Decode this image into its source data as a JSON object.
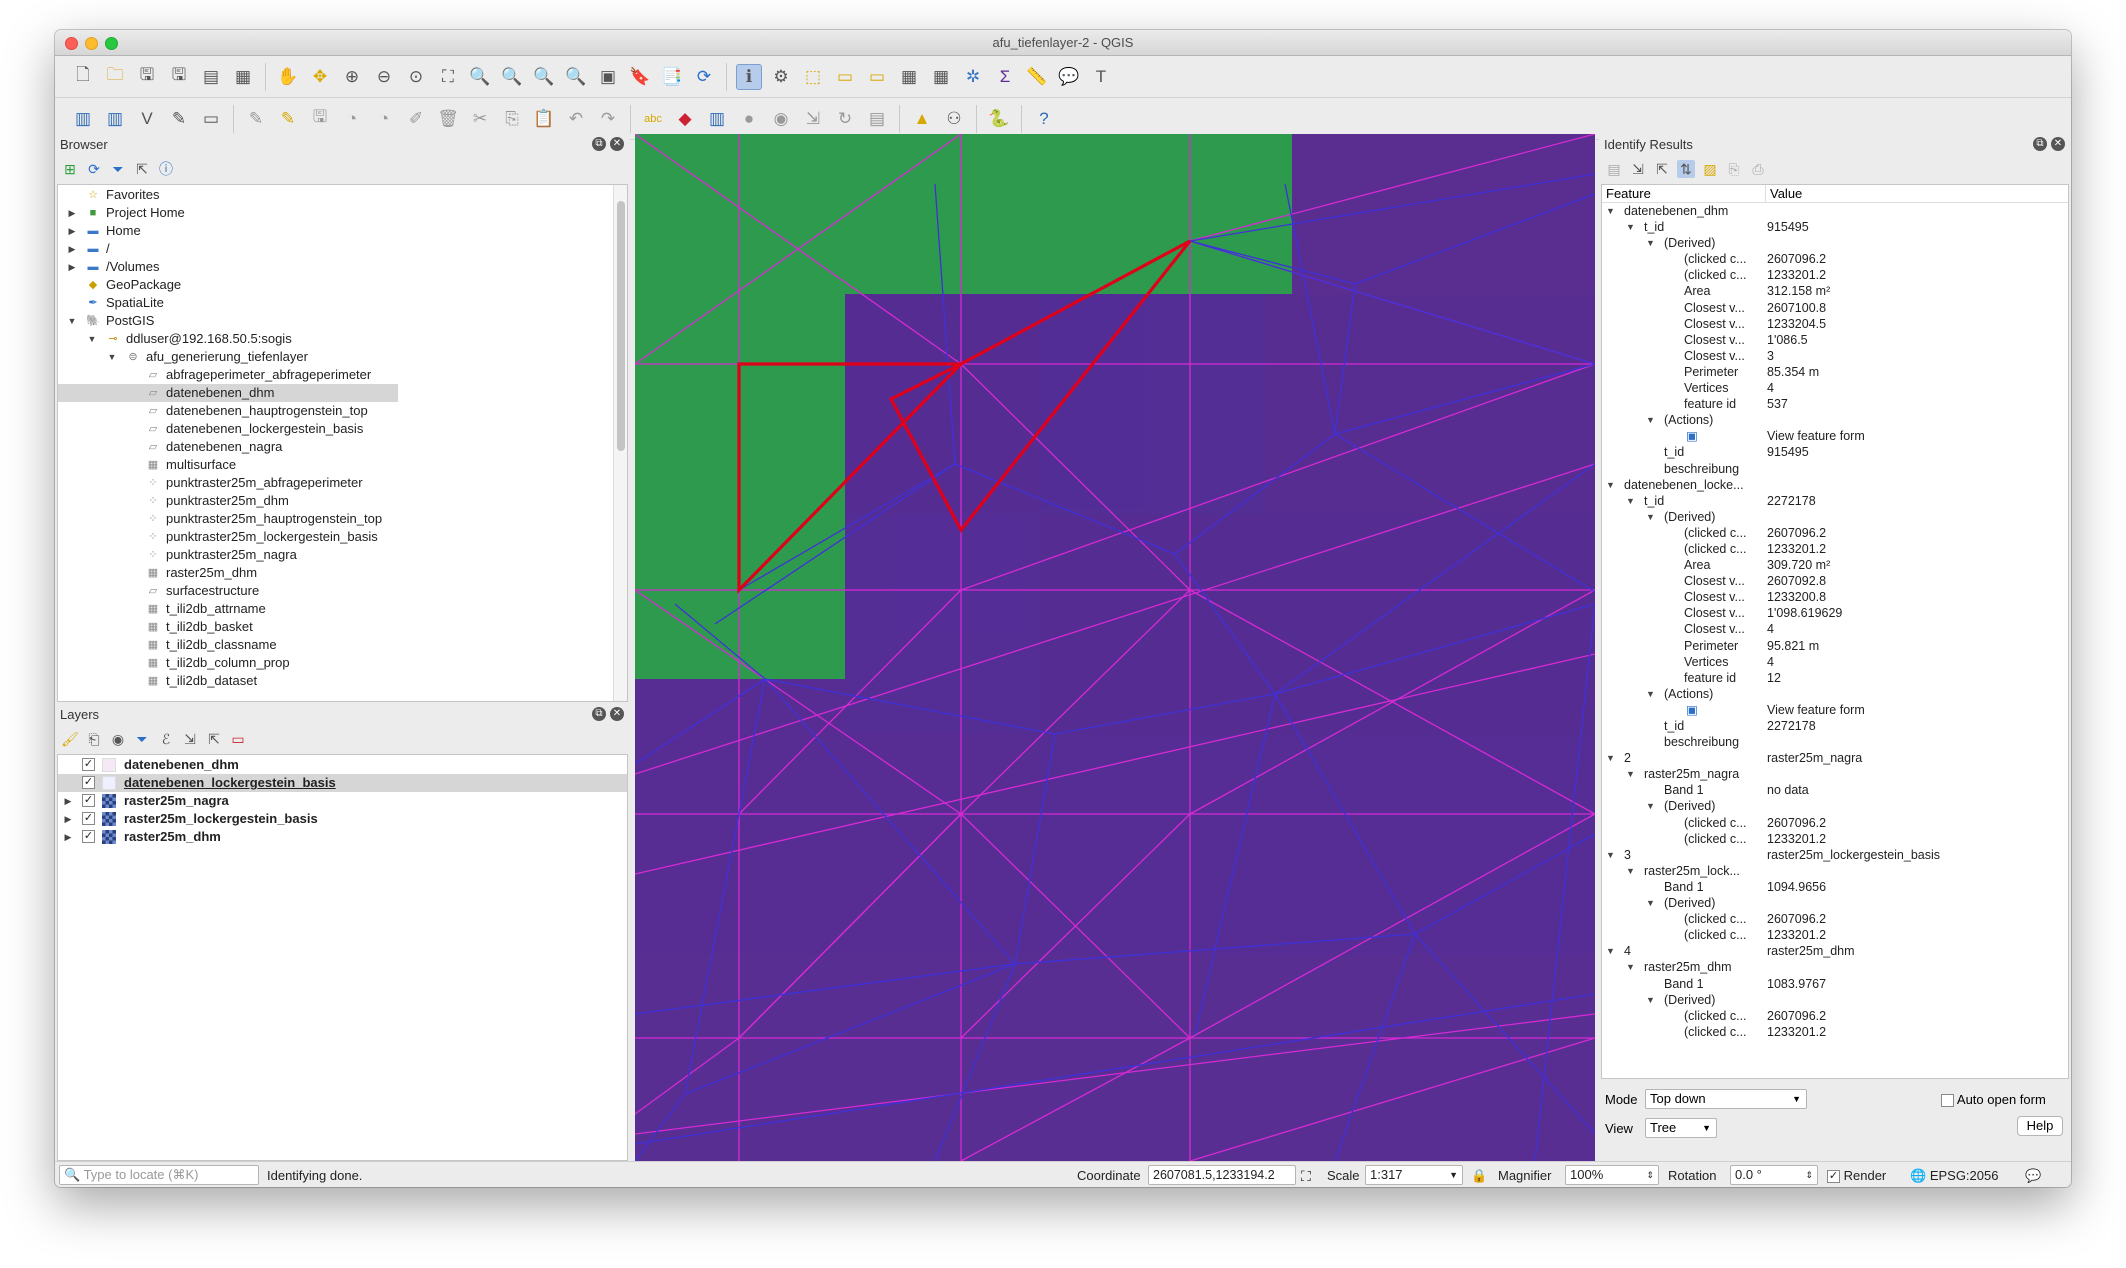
{
  "window": {
    "title": "afu_tiefenlayer-2 - QGIS"
  },
  "colors": {
    "map_bg": "#552c91",
    "green": "#2e9a4e",
    "red": "#e0001a",
    "magenta": "#d62ad3",
    "blue": "#3f31d9"
  },
  "browser": {
    "title": "Browser",
    "items": [
      {
        "label": "Favorites",
        "icon": "star-icon",
        "level": 0,
        "expand": ""
      },
      {
        "label": "Project Home",
        "icon": "project-home-icon",
        "level": 0,
        "expand": "▶"
      },
      {
        "label": "Home",
        "icon": "folder-icon",
        "level": 0,
        "expand": "▶"
      },
      {
        "label": "/",
        "icon": "folder-icon",
        "level": 0,
        "expand": "▶"
      },
      {
        "label": "/Volumes",
        "icon": "folder-icon",
        "level": 0,
        "expand": "▶"
      },
      {
        "label": "GeoPackage",
        "icon": "geopackage-icon",
        "level": 0,
        "expand": ""
      },
      {
        "label": "SpatiaLite",
        "icon": "spatialite-icon",
        "level": 0,
        "expand": ""
      },
      {
        "label": "PostGIS",
        "icon": "postgis-icon",
        "level": 0,
        "expand": "▼"
      },
      {
        "label": "ddluser@192.168.50.5:sogis",
        "icon": "connection-icon",
        "level": 1,
        "expand": "▼"
      },
      {
        "label": "afu_generierung_tiefenlayer",
        "icon": "schema-icon",
        "level": 2,
        "expand": "▼"
      },
      {
        "label": "abfrageperimeter_abfrageperimeter",
        "icon": "polygon-layer-icon",
        "level": 3,
        "expand": ""
      },
      {
        "label": "datenebenen_dhm",
        "icon": "polygon-layer-icon",
        "level": 3,
        "expand": "",
        "selected": true
      },
      {
        "label": "datenebenen_hauptrogenstein_top",
        "icon": "polygon-layer-icon",
        "level": 3,
        "expand": ""
      },
      {
        "label": "datenebenen_lockergestein_basis",
        "icon": "polygon-layer-icon",
        "level": 3,
        "expand": ""
      },
      {
        "label": "datenebenen_nagra",
        "icon": "polygon-layer-icon",
        "level": 3,
        "expand": ""
      },
      {
        "label": "multisurface",
        "icon": "table-icon",
        "level": 3,
        "expand": ""
      },
      {
        "label": "punktraster25m_abfrageperimeter",
        "icon": "point-layer-icon",
        "level": 3,
        "expand": ""
      },
      {
        "label": "punktraster25m_dhm",
        "icon": "point-layer-icon",
        "level": 3,
        "expand": ""
      },
      {
        "label": "punktraster25m_hauptrogenstein_top",
        "icon": "point-layer-icon",
        "level": 3,
        "expand": ""
      },
      {
        "label": "punktraster25m_lockergestein_basis",
        "icon": "point-layer-icon",
        "level": 3,
        "expand": ""
      },
      {
        "label": "punktraster25m_nagra",
        "icon": "point-layer-icon",
        "level": 3,
        "expand": ""
      },
      {
        "label": "raster25m_dhm",
        "icon": "table-icon",
        "level": 3,
        "expand": ""
      },
      {
        "label": "surfacestructure",
        "icon": "polygon-layer-icon",
        "level": 3,
        "expand": ""
      },
      {
        "label": "t_ili2db_attrname",
        "icon": "table-icon",
        "level": 3,
        "expand": ""
      },
      {
        "label": "t_ili2db_basket",
        "icon": "table-icon",
        "level": 3,
        "expand": ""
      },
      {
        "label": "t_ili2db_classname",
        "icon": "table-icon",
        "level": 3,
        "expand": ""
      },
      {
        "label": "t_ili2db_column_prop",
        "icon": "table-icon",
        "level": 3,
        "expand": ""
      },
      {
        "label": "t_ili2db_dataset",
        "icon": "table-icon",
        "level": 3,
        "expand": ""
      }
    ]
  },
  "layers": {
    "title": "Layers",
    "items": [
      {
        "label": "datenebenen_dhm",
        "expand": "",
        "checked": "✓",
        "swatch": "#f4e9f4",
        "underline": false
      },
      {
        "label": "datenebenen_lockergestein_basis",
        "expand": "",
        "checked": "✓",
        "swatch": "#eef0ff",
        "underline": true,
        "selected": true
      },
      {
        "label": "raster25m_nagra",
        "expand": "▶",
        "checked": "✓",
        "swatch": "raster",
        "underline": false
      },
      {
        "label": "raster25m_lockergestein_basis",
        "expand": "▶",
        "checked": "✓",
        "swatch": "raster",
        "underline": false
      },
      {
        "label": "raster25m_dhm",
        "expand": "▶",
        "checked": "✓",
        "swatch": "raster",
        "underline": false
      }
    ]
  },
  "identify": {
    "title": "Identify Results",
    "col_feature": "Feature",
    "col_value": "Value",
    "rows": [
      {
        "k": "datenebenen_dhm",
        "v": "",
        "lvl": 0,
        "a": "▼"
      },
      {
        "k": "t_id",
        "v": "915495",
        "lvl": 1,
        "a": "▼"
      },
      {
        "k": "(Derived)",
        "v": "",
        "lvl": 2,
        "a": "▼"
      },
      {
        "k": "(clicked c...",
        "v": "2607096.2",
        "lvl": 3,
        "a": ""
      },
      {
        "k": "(clicked c...",
        "v": "1233201.2",
        "lvl": 3,
        "a": ""
      },
      {
        "k": "Area",
        "v": "312.158 m²",
        "lvl": 3,
        "a": ""
      },
      {
        "k": "Closest v...",
        "v": "2607100.8",
        "lvl": 3,
        "a": ""
      },
      {
        "k": "Closest v...",
        "v": "1233204.5",
        "lvl": 3,
        "a": ""
      },
      {
        "k": "Closest v...",
        "v": "1'086.5",
        "lvl": 3,
        "a": ""
      },
      {
        "k": "Closest v...",
        "v": "3",
        "lvl": 3,
        "a": ""
      },
      {
        "k": "Perimeter",
        "v": "85.354 m",
        "lvl": 3,
        "a": ""
      },
      {
        "k": "Vertices",
        "v": "4",
        "lvl": 3,
        "a": ""
      },
      {
        "k": "feature id",
        "v": "537",
        "lvl": 3,
        "a": ""
      },
      {
        "k": "(Actions)",
        "v": "",
        "lvl": 2,
        "a": "▼"
      },
      {
        "k": "▣",
        "v": "View feature form",
        "lvl": 3,
        "a": ""
      },
      {
        "k": "t_id",
        "v": "915495",
        "lvl": 2,
        "a": ""
      },
      {
        "k": "beschreibung",
        "v": "",
        "lvl": 2,
        "a": ""
      },
      {
        "k": "datenebenen_locke...",
        "v": "",
        "lvl": 0,
        "a": "▼"
      },
      {
        "k": "t_id",
        "v": "2272178",
        "lvl": 1,
        "a": "▼"
      },
      {
        "k": "(Derived)",
        "v": "",
        "lvl": 2,
        "a": "▼"
      },
      {
        "k": "(clicked c...",
        "v": "2607096.2",
        "lvl": 3,
        "a": ""
      },
      {
        "k": "(clicked c...",
        "v": "1233201.2",
        "lvl": 3,
        "a": ""
      },
      {
        "k": "Area",
        "v": "309.720 m²",
        "lvl": 3,
        "a": ""
      },
      {
        "k": "Closest v...",
        "v": "2607092.8",
        "lvl": 3,
        "a": ""
      },
      {
        "k": "Closest v...",
        "v": "1233200.8",
        "lvl": 3,
        "a": ""
      },
      {
        "k": "Closest v...",
        "v": "1'098.619629",
        "lvl": 3,
        "a": ""
      },
      {
        "k": "Closest v...",
        "v": "4",
        "lvl": 3,
        "a": ""
      },
      {
        "k": "Perimeter",
        "v": "95.821 m",
        "lvl": 3,
        "a": ""
      },
      {
        "k": "Vertices",
        "v": "4",
        "lvl": 3,
        "a": ""
      },
      {
        "k": "feature id",
        "v": "12",
        "lvl": 3,
        "a": ""
      },
      {
        "k": "(Actions)",
        "v": "",
        "lvl": 2,
        "a": "▼"
      },
      {
        "k": "▣",
        "v": "View feature form",
        "lvl": 3,
        "a": ""
      },
      {
        "k": "t_id",
        "v": "2272178",
        "lvl": 2,
        "a": ""
      },
      {
        "k": "beschreibung",
        "v": "",
        "lvl": 2,
        "a": ""
      },
      {
        "k": "2",
        "v": "raster25m_nagra",
        "lvl": 0,
        "a": "▼"
      },
      {
        "k": "raster25m_nagra",
        "v": "",
        "lvl": 1,
        "a": "▼"
      },
      {
        "k": "Band 1",
        "v": "no data",
        "lvl": 2,
        "a": ""
      },
      {
        "k": "(Derived)",
        "v": "",
        "lvl": 2,
        "a": "▼"
      },
      {
        "k": "(clicked c...",
        "v": "2607096.2",
        "lvl": 3,
        "a": ""
      },
      {
        "k": "(clicked c...",
        "v": "1233201.2",
        "lvl": 3,
        "a": ""
      },
      {
        "k": "3",
        "v": "raster25m_lockergestein_basis",
        "lvl": 0,
        "a": "▼"
      },
      {
        "k": "raster25m_lock...",
        "v": "",
        "lvl": 1,
        "a": "▼"
      },
      {
        "k": "Band 1",
        "v": "1094.9656",
        "lvl": 2,
        "a": ""
      },
      {
        "k": "(Derived)",
        "v": "",
        "lvl": 2,
        "a": "▼"
      },
      {
        "k": "(clicked c...",
        "v": "2607096.2",
        "lvl": 3,
        "a": ""
      },
      {
        "k": "(clicked c...",
        "v": "1233201.2",
        "lvl": 3,
        "a": ""
      },
      {
        "k": "4",
        "v": "raster25m_dhm",
        "lvl": 0,
        "a": "▼"
      },
      {
        "k": "raster25m_dhm",
        "v": "",
        "lvl": 1,
        "a": "▼"
      },
      {
        "k": "Band 1",
        "v": "1083.9767",
        "lvl": 2,
        "a": ""
      },
      {
        "k": "(Derived)",
        "v": "",
        "lvl": 2,
        "a": "▼"
      },
      {
        "k": "(clicked c...",
        "v": "2607096.2",
        "lvl": 3,
        "a": ""
      },
      {
        "k": "(clicked c...",
        "v": "1233201.2",
        "lvl": 3,
        "a": ""
      }
    ],
    "mode_label": "Mode",
    "mode_value": "Top down",
    "view_label": "View",
    "view_value": "Tree",
    "auto_open": "Auto open form",
    "help": "Help"
  },
  "status": {
    "locate_placeholder": "Type to locate (⌘K)",
    "message": "Identifying done.",
    "coord_label": "Coordinate",
    "coord_value": "2607081.5,1233194.2",
    "scale_label": "Scale",
    "scale_value": "1:317",
    "magnifier_label": "Magnifier",
    "magnifier_value": "100%",
    "rotation_label": "Rotation",
    "rotation_value": "0.0 °",
    "render_label": "Render",
    "crs": "EPSG:2056"
  }
}
